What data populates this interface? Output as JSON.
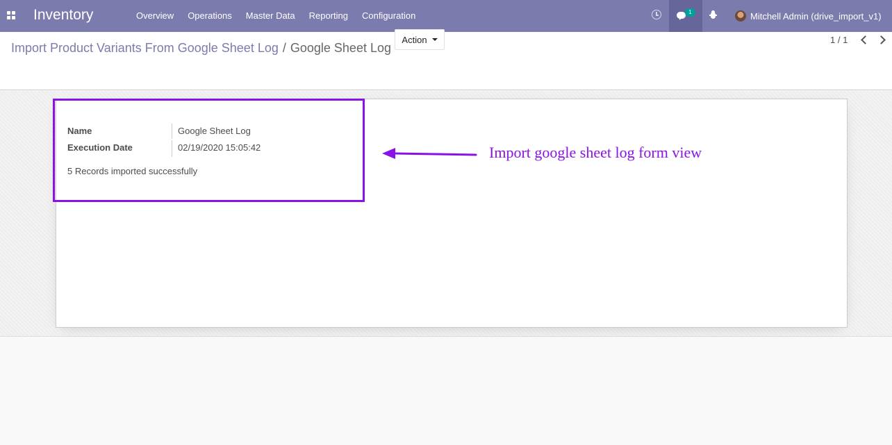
{
  "navbar": {
    "app_title": "Inventory",
    "menu": [
      "Overview",
      "Operations",
      "Master Data",
      "Reporting",
      "Configuration"
    ],
    "chat_count": "1",
    "user_name": "Mitchell Admin (drive_import_v1)",
    "bg_color": "#7c7bad"
  },
  "breadcrumb": {
    "parent": "Import Product Variants From Google Sheet Log",
    "separator": "/",
    "current": "Google Sheet Log"
  },
  "control": {
    "action_label": "Action",
    "pager": "1 / 1"
  },
  "form": {
    "fields": [
      {
        "label": "Name",
        "value": "Google Sheet Log"
      },
      {
        "label": "Execution Date",
        "value": "02/19/2020 15:05:42"
      }
    ],
    "message": "5 Records imported successfully"
  },
  "annotation": {
    "text": "Import google sheet log form view",
    "color": "#8a12e6"
  }
}
